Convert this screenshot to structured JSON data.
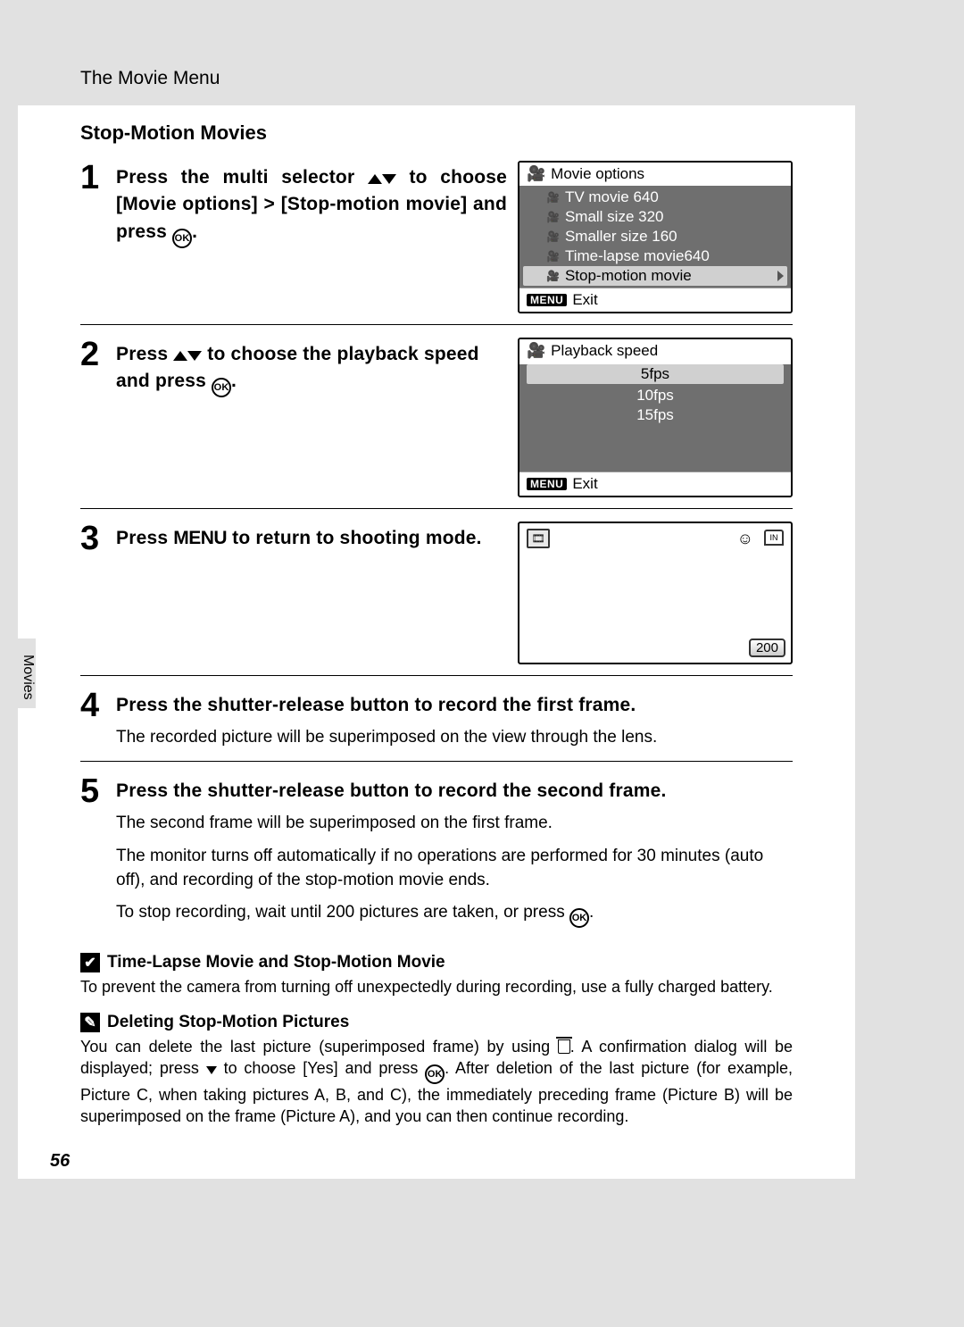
{
  "header": "The Movie Menu",
  "section_title": "Stop-Motion Movies",
  "side_tab": "Movies",
  "page_number": "56",
  "steps": {
    "s1": {
      "num": "1",
      "t1": "Press the multi selector ",
      "t2": " to choose [Movie options] > [Stop-motion movie] and press ",
      "t3": "."
    },
    "s2": {
      "num": "2",
      "t1": "Press ",
      "t2": " to choose the playback speed and press ",
      "t3": "."
    },
    "s3": {
      "num": "3",
      "t1": "Press ",
      "menu": "MENU",
      "t2": " to return to shooting mode."
    },
    "s4": {
      "num": "4",
      "title": "Press the shutter-release button to record the first frame.",
      "sub": "The recorded picture will be superimposed on the view through the lens."
    },
    "s5": {
      "num": "5",
      "title": "Press the shutter-release button to record the second frame.",
      "sub1": "The second frame will be superimposed on the first frame.",
      "sub2": "The monitor turns off automatically if no operations are performed for 30 minutes (auto off), and recording of the stop-motion movie ends.",
      "sub3a": "To stop recording, wait until 200 pictures are taken, or press ",
      "sub3b": "."
    }
  },
  "lcd1": {
    "title": "Movie options",
    "items": [
      "TV movie 640",
      "Small size 320",
      "Smaller size 160",
      "Time-lapse movie640",
      "Stop-motion movie"
    ],
    "exit": "Exit",
    "menu_chip": "MENU"
  },
  "lcd2": {
    "title": "Playback speed",
    "items": [
      "5fps",
      "10fps",
      "15fps"
    ],
    "exit": "Exit",
    "menu_chip": "MENU"
  },
  "lcd3": {
    "counter": "200",
    "in": "IN"
  },
  "note1": {
    "icon": "✔",
    "title": "Time-Lapse Movie and Stop-Motion Movie",
    "body": "To prevent the camera from turning off unexpectedly during recording, use a fully charged battery."
  },
  "note2": {
    "icon": "✎",
    "title": "Deleting Stop-Motion Pictures",
    "b1": "You can delete the last picture (superimposed frame) by using ",
    "b2": ". A confirmation dialog will be displayed; press ",
    "b3": " to choose [Yes] and press ",
    "b4": ". After deletion of the last picture (for example, Picture C, when taking pictures A, B, and C), the immediately preceding frame (Picture B) will be superimposed on the frame (Picture A), and you can then continue recording."
  }
}
